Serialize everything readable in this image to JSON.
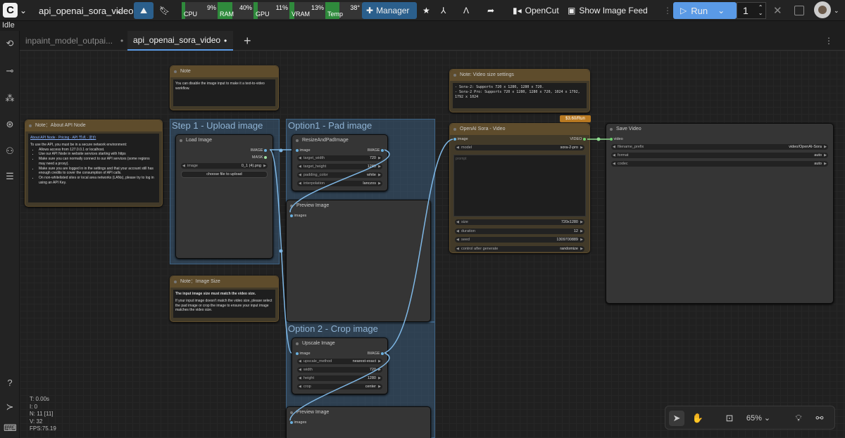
{
  "topbar": {
    "workflow_name": "api_openai_sora_video",
    "manager_label": "Manager",
    "opencut_label": "OpenCut",
    "show_feed_label": "Show Image Feed",
    "run_label": "Run",
    "batch_count": "1"
  },
  "resources": [
    {
      "name": "CPU",
      "percent": "9%",
      "level": 0.09
    },
    {
      "name": "RAM",
      "percent": "40%",
      "level": 0.4
    },
    {
      "name": "GPU",
      "percent": "11%",
      "level": 0.11
    },
    {
      "name": "VRAM",
      "percent": "13%",
      "level": 0.13
    },
    {
      "name": "Temp",
      "percent": "38°",
      "level": 0.38
    }
  ],
  "status": "Idle",
  "tabs": [
    {
      "label": "inpaint_model_outpai...",
      "active": false
    },
    {
      "label": "api_openai_sora_video",
      "active": true
    }
  ],
  "groups": {
    "step1": "Step 1 - Upload image",
    "opt1": "Option1 - Pad image",
    "opt2": "Option 2 - Crop image"
  },
  "notes": {
    "api_title": "Note：About API Node",
    "api_links": "About API Node · Pricing · API 节点 · 定价",
    "api_intro": "To use the API, you must be in a secure network environment:",
    "api_items": [
      "Allows access from 127.0.0.1 or localhost.",
      "Use our API Node in website services starting with https",
      "Make sure you can normally connect to our API services (some regions may need a proxy).",
      "Make sure you are logged in in the settings and that your account still has enough credits to cover the consumption of API calls.",
      "On non-whitelisted sites or local area networks (LANs), please try to log in using an API Key."
    ],
    "top_title": "Note",
    "top_text": "You can disable the image input to make it a text-to-video workflow.",
    "size_title": "Note：Image Size",
    "size_bold": "The input image size must match the video size.",
    "size_text": "If your input image doesn't match the video size, please select the pad image or crop the image to ensure your input image matches the video size.",
    "vid_title": "Note: Video size settings",
    "vid_l1": "- Sora-2: Supports 720 x 1280, 1280 x 720.",
    "vid_l2": "- Sora-2 Pro: Supports 720 x 1280, 1280 x 720, 1024 x 1792, 1792 x 1024"
  },
  "load_image": {
    "title": "Load Image",
    "out1": "IMAGE",
    "out2": "MASK",
    "image_label": "image",
    "image_value": "0_1 (4).png",
    "upload_label": "choose file to upload"
  },
  "resize": {
    "title": "ResizeAndPadImage",
    "in": "image",
    "out": "IMAGE",
    "w": [
      {
        "l": "target_width",
        "v": "720"
      },
      {
        "l": "target_height",
        "v": "1280"
      },
      {
        "l": "padding_color",
        "v": "white"
      },
      {
        "l": "interpolation",
        "v": "lanczos"
      }
    ]
  },
  "preview1": {
    "title": "Preview Image",
    "in": "images"
  },
  "upscale": {
    "title": "Upscale Image",
    "in": "image",
    "out": "IMAGE",
    "w": [
      {
        "l": "upscale_method",
        "v": "nearest-exact"
      },
      {
        "l": "width",
        "v": "720"
      },
      {
        "l": "height",
        "v": "1280"
      },
      {
        "l": "crop",
        "v": "center"
      }
    ]
  },
  "preview2": {
    "title": "Preview Image",
    "in": "images"
  },
  "sora": {
    "badge": "$3.60/Run",
    "title": "OpenAI Sora - Video",
    "in": "image",
    "out": "VIDEO",
    "model_l": "model",
    "model_v": "sora-2-pro",
    "prompt_ph": "prompt",
    "w": [
      {
        "l": "size",
        "v": "720x1280"
      },
      {
        "l": "duration",
        "v": "12"
      },
      {
        "l": "seed",
        "v": "1309700889"
      },
      {
        "l": "control after generate",
        "v": "randomize"
      }
    ]
  },
  "save": {
    "title": "Save Video",
    "in": "video",
    "w": [
      {
        "l": "filename_prefix",
        "v": "video/OpenAI-Sora"
      },
      {
        "l": "format",
        "v": "auto"
      },
      {
        "l": "codec",
        "v": "auto"
      }
    ]
  },
  "zoom": "65%",
  "perf": {
    "t": "T: 0.00s",
    "i": "I: 0",
    "n": "N: 11 [11]",
    "v": "V: 32",
    "fps": "FPS:75.19"
  }
}
